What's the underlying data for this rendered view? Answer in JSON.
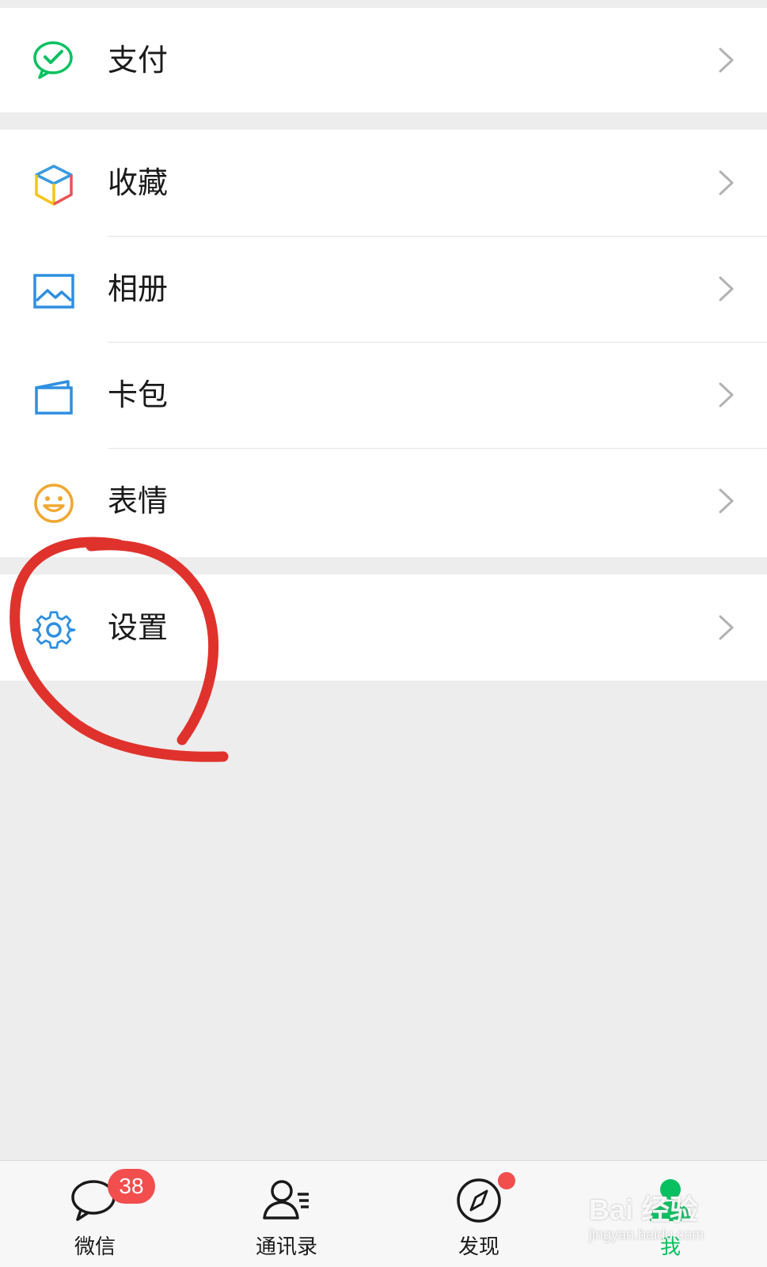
{
  "menu": {
    "pay": {
      "label": "支付"
    },
    "favorites": {
      "label": "收藏"
    },
    "album": {
      "label": "相册"
    },
    "cards": {
      "label": "卡包"
    },
    "stickers": {
      "label": "表情"
    },
    "settings": {
      "label": "设置"
    }
  },
  "tabbar": {
    "chats": {
      "label": "微信",
      "badge": "38"
    },
    "contacts": {
      "label": "通讯录"
    },
    "discover": {
      "label": "发现"
    },
    "me": {
      "label": "我"
    }
  },
  "watermark": {
    "logo": "Bai 经验",
    "sub": "jingyan.baidu.com"
  },
  "colors": {
    "accent_green": "#07c160",
    "badge_red": "#f24e4e",
    "annotation_red": "#e0322c"
  },
  "icons": {
    "pay": "wechat-pay-icon",
    "favorites": "cube-icon",
    "album": "picture-icon",
    "cards": "wallet-card-icon",
    "stickers": "smiley-icon",
    "settings": "gear-icon",
    "chats": "chat-bubble-icon",
    "contacts": "contacts-icon",
    "discover": "compass-icon",
    "me": "person-icon"
  }
}
